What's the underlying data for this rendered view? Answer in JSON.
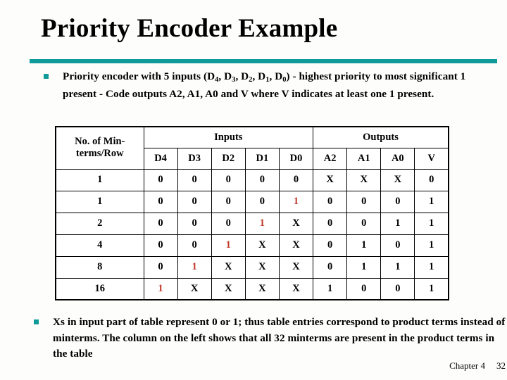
{
  "slide": {
    "title": "Priority Encoder Example",
    "accent_color": "#119a9a",
    "highlight_color": "#c0392b",
    "background_color": "#fdfdfb"
  },
  "bullets": [
    {
      "marker": "square-bullet",
      "segments": [
        {
          "t": "Priority encoder with 5 inputs (D"
        },
        {
          "t": "4",
          "sub": true
        },
        {
          "t": ", D"
        },
        {
          "t": "3",
          "sub": true
        },
        {
          "t": ", D"
        },
        {
          "t": "2",
          "sub": true
        },
        {
          "t": ", D"
        },
        {
          "t": "1",
          "sub": true
        },
        {
          "t": ", D"
        },
        {
          "t": "0",
          "sub": true
        },
        {
          "t": ") - highest priority to most significant 1 present - Code outputs A2, A1, A0 and V where V indicates at least one 1 present."
        }
      ],
      "plain": "Priority encoder with 5 inputs (D4, D3, D2, D1, D0) - highest priority to most significant 1 present - Code outputs A2, A1, A0 and V where V indicates at least one 1 present."
    },
    {
      "marker": "square-bullet",
      "segments": [
        {
          "t": "Xs in input part of table represent 0 or 1; thus table entries correspond to product terms instead of minterms. The column on the left shows that all 32 minterms are present in the product terms in the table"
        }
      ],
      "plain": "Xs in input part of table represent 0 or 1; thus table entries correspond to product terms instead of minterms. The column on the left shows that all 32 minterms are present in the product terms in the table"
    }
  ],
  "table": {
    "row_label_header": "No. of Min-terms/Row",
    "row_label_line1": "No. of Min-",
    "row_label_line2": "terms/Row",
    "group_headers": [
      "Inputs",
      "Outputs"
    ],
    "input_columns": [
      "D4",
      "D3",
      "D2",
      "D1",
      "D0"
    ],
    "output_columns": [
      "A2",
      "A1",
      "A0",
      "V"
    ],
    "rows": [
      {
        "minterms": "1",
        "inputs": [
          {
            "v": "0"
          },
          {
            "v": "0"
          },
          {
            "v": "0"
          },
          {
            "v": "0"
          },
          {
            "v": "0"
          }
        ],
        "outputs": [
          {
            "v": "X"
          },
          {
            "v": "X"
          },
          {
            "v": "X"
          },
          {
            "v": "0"
          }
        ]
      },
      {
        "minterms": "1",
        "inputs": [
          {
            "v": "0"
          },
          {
            "v": "0"
          },
          {
            "v": "0"
          },
          {
            "v": "0"
          },
          {
            "v": "1",
            "hot": true
          }
        ],
        "outputs": [
          {
            "v": "0"
          },
          {
            "v": "0"
          },
          {
            "v": "0"
          },
          {
            "v": "1"
          }
        ]
      },
      {
        "minterms": "2",
        "inputs": [
          {
            "v": "0"
          },
          {
            "v": "0"
          },
          {
            "v": "0"
          },
          {
            "v": "1",
            "hot": true
          },
          {
            "v": "X"
          }
        ],
        "outputs": [
          {
            "v": "0"
          },
          {
            "v": "0"
          },
          {
            "v": "1"
          },
          {
            "v": "1"
          }
        ]
      },
      {
        "minterms": "4",
        "inputs": [
          {
            "v": "0"
          },
          {
            "v": "0"
          },
          {
            "v": "1",
            "hot": true
          },
          {
            "v": "X"
          },
          {
            "v": "X"
          }
        ],
        "outputs": [
          {
            "v": "0"
          },
          {
            "v": "1"
          },
          {
            "v": "0"
          },
          {
            "v": "1"
          }
        ]
      },
      {
        "minterms": "8",
        "inputs": [
          {
            "v": "0"
          },
          {
            "v": "1",
            "hot": true
          },
          {
            "v": "X"
          },
          {
            "v": "X"
          },
          {
            "v": "X"
          }
        ],
        "outputs": [
          {
            "v": "0"
          },
          {
            "v": "1"
          },
          {
            "v": "1"
          },
          {
            "v": "1"
          }
        ]
      },
      {
        "minterms": "16",
        "inputs": [
          {
            "v": "1",
            "hot": true
          },
          {
            "v": "X"
          },
          {
            "v": "X"
          },
          {
            "v": "X"
          },
          {
            "v": "X"
          }
        ],
        "outputs": [
          {
            "v": "1"
          },
          {
            "v": "0"
          },
          {
            "v": "0"
          },
          {
            "v": "1"
          }
        ]
      }
    ]
  },
  "footer": {
    "chapter": "Chapter 4",
    "page": "32"
  }
}
